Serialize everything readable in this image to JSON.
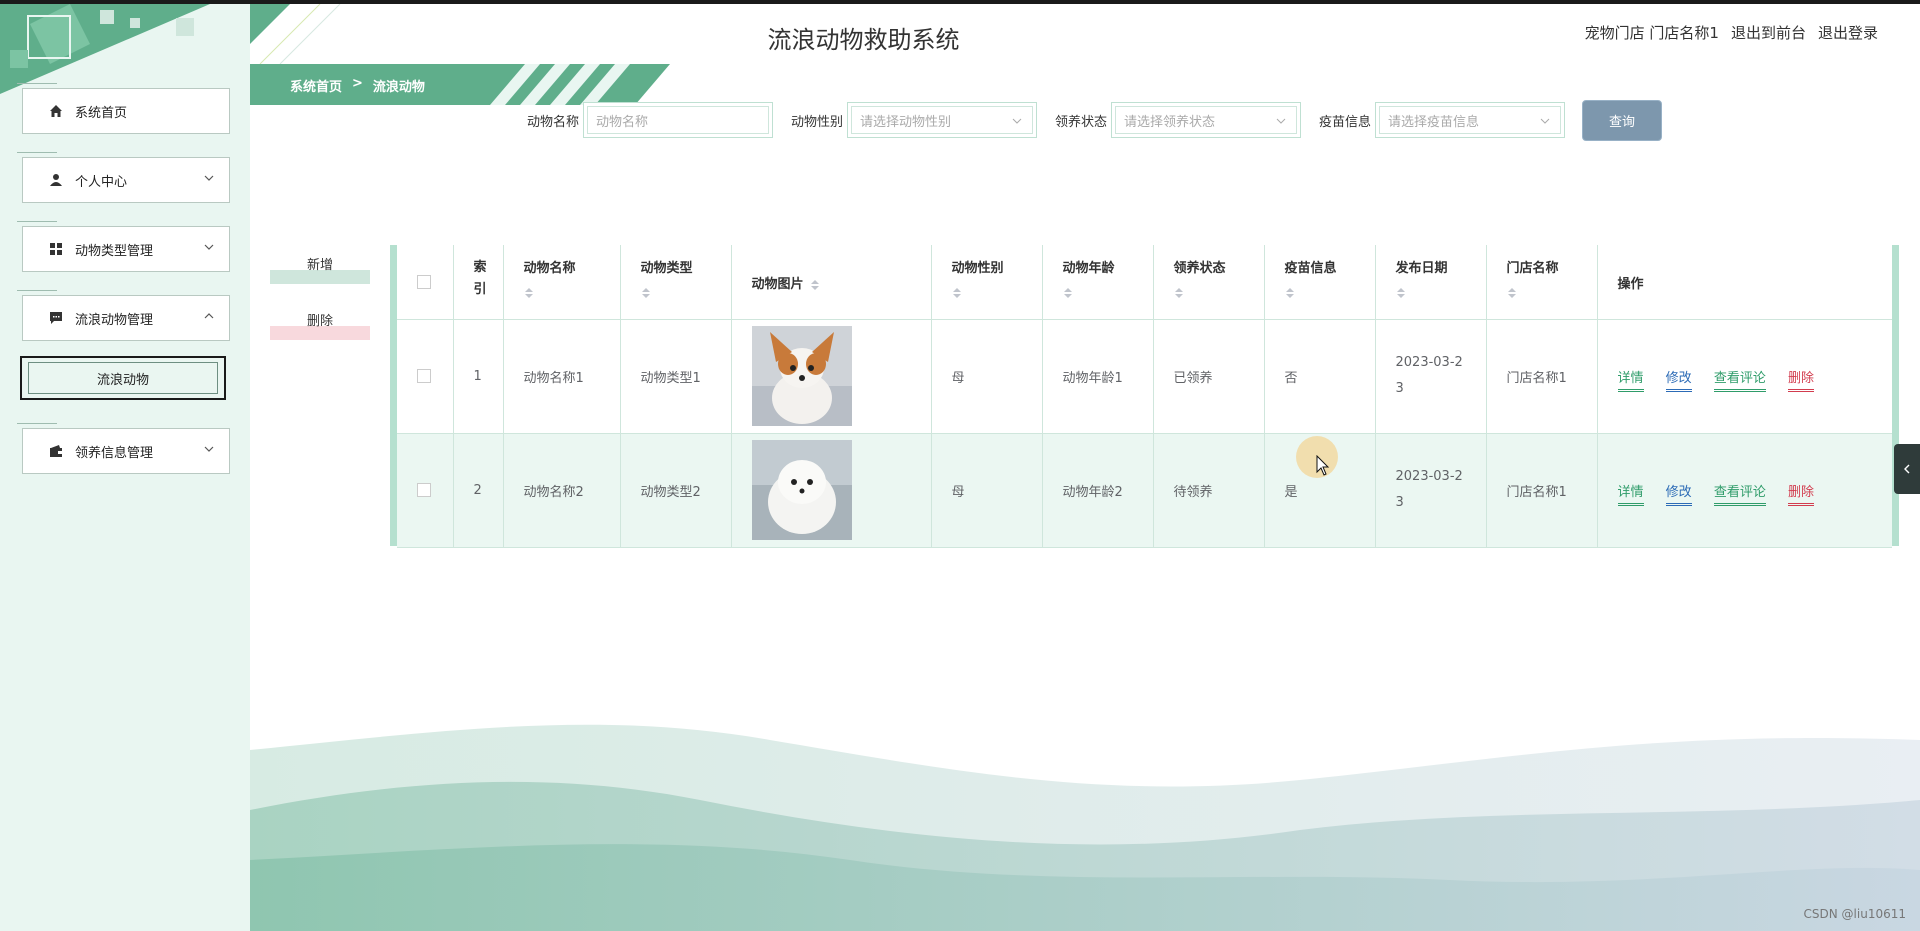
{
  "header": {
    "title": "流浪动物救助系统",
    "links": [
      "宠物门店 门店名称1",
      "退出到前台",
      "退出登录"
    ]
  },
  "breadcrumb": {
    "home": "系统首页",
    "separator": ">",
    "current": "流浪动物"
  },
  "sidebar": {
    "items": [
      {
        "label": "系统首页",
        "icon": "home-icon"
      },
      {
        "label": "个人中心",
        "icon": "user-icon"
      },
      {
        "label": "动物类型管理",
        "icon": "grid-icon"
      },
      {
        "label": "流浪动物管理",
        "icon": "message-icon"
      },
      {
        "label": "领养信息管理",
        "icon": "wallet-icon"
      }
    ],
    "sub_item": "流浪动物"
  },
  "search": {
    "name_label": "动物名称",
    "name_placeholder": "动物名称",
    "gender_label": "动物性别",
    "gender_placeholder": "请选择动物性别",
    "status_label": "领养状态",
    "status_placeholder": "请选择领养状态",
    "vaccine_label": "疫苗信息",
    "vaccine_placeholder": "请选择疫苗信息",
    "query_button": "查询"
  },
  "actions": {
    "add": "新增",
    "delete": "删除"
  },
  "table": {
    "headers": [
      "索引",
      "动物名称",
      "动物类型",
      "动物图片",
      "动物性别",
      "动物年龄",
      "领养状态",
      "疫苗信息",
      "发布日期",
      "门店名称",
      "操作"
    ],
    "rows": [
      {
        "index": "1",
        "name": "动物名称1",
        "type": "动物类型1",
        "gender": "母",
        "age": "动物年龄1",
        "status": "已领养",
        "vaccine": "否",
        "date": "2023-03-23",
        "store": "门店名称1"
      },
      {
        "index": "2",
        "name": "动物名称2",
        "type": "动物类型2",
        "gender": "母",
        "age": "动物年龄2",
        "status": "待领养",
        "vaccine": "是",
        "date": "2023-03-23",
        "store": "门店名称1"
      }
    ],
    "ops": [
      "详情",
      "修改",
      "查看评论",
      "删除"
    ]
  },
  "watermark": "CSDN @liu10611",
  "colors": {
    "accent": "#5fae8b",
    "sidebar_bg": "#e9f6f1",
    "query_button": "#7d97ad",
    "delete_red": "#d23c4e"
  }
}
